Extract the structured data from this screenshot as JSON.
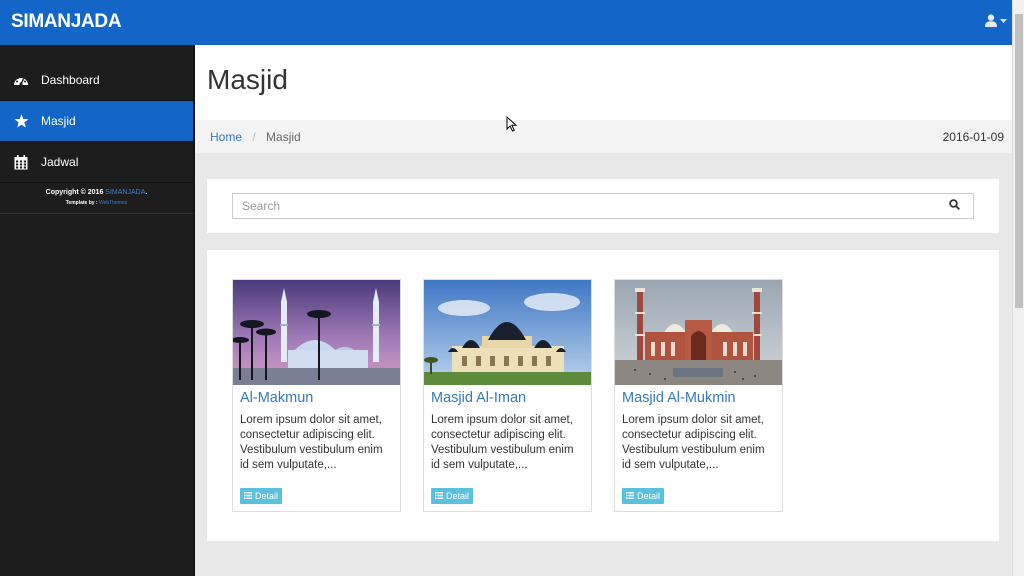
{
  "app": {
    "brand": "SIMANJADA"
  },
  "topbar": {
    "user_icon": "user-icon",
    "caret_icon": "caret-down-icon"
  },
  "sidebar": {
    "items": [
      {
        "label": "Dashboard",
        "icon": "dashboard-icon",
        "active": false
      },
      {
        "label": "Masjid",
        "icon": "star-icon",
        "active": true
      },
      {
        "label": "Jadwal",
        "icon": "calendar-icon",
        "active": false
      }
    ],
    "copyright": {
      "prefix": "Copyright © 2016",
      "link": "SIMANJADA",
      "suffix": ".",
      "template_prefix": "Template by :",
      "template_link": "WebThemez"
    }
  },
  "page": {
    "title": "Masjid",
    "breadcrumb": {
      "home": "Home",
      "separator": "/",
      "current": "Masjid"
    },
    "date": "2016-01-09"
  },
  "search": {
    "placeholder": "Search",
    "value": "",
    "icon": "search-icon"
  },
  "cards": [
    {
      "title": "Al-Makmun",
      "text": "Lorem ipsum dolor sit amet, consectetur adipiscing elit. Vestibulum vestibulum enim id sem vulputate,...",
      "button": "Detail",
      "button_icon": "list-icon"
    },
    {
      "title": "Masjid Al-Iman",
      "text": "Lorem ipsum dolor sit amet, consectetur adipiscing elit. Vestibulum vestibulum enim id sem vulputate,...",
      "button": "Detail",
      "button_icon": "list-icon"
    },
    {
      "title": "Masjid Al-Mukmin",
      "text": "Lorem ipsum dolor sit amet, consectetur adipiscing elit. Vestibulum vestibulum enim id sem vulputate,...",
      "button": "Detail",
      "button_icon": "list-icon"
    }
  ],
  "colors": {
    "primary": "#1465c8",
    "sidebar_bg": "#1d1d1d",
    "link": "#337ab7",
    "info_button": "#5bc0de"
  }
}
